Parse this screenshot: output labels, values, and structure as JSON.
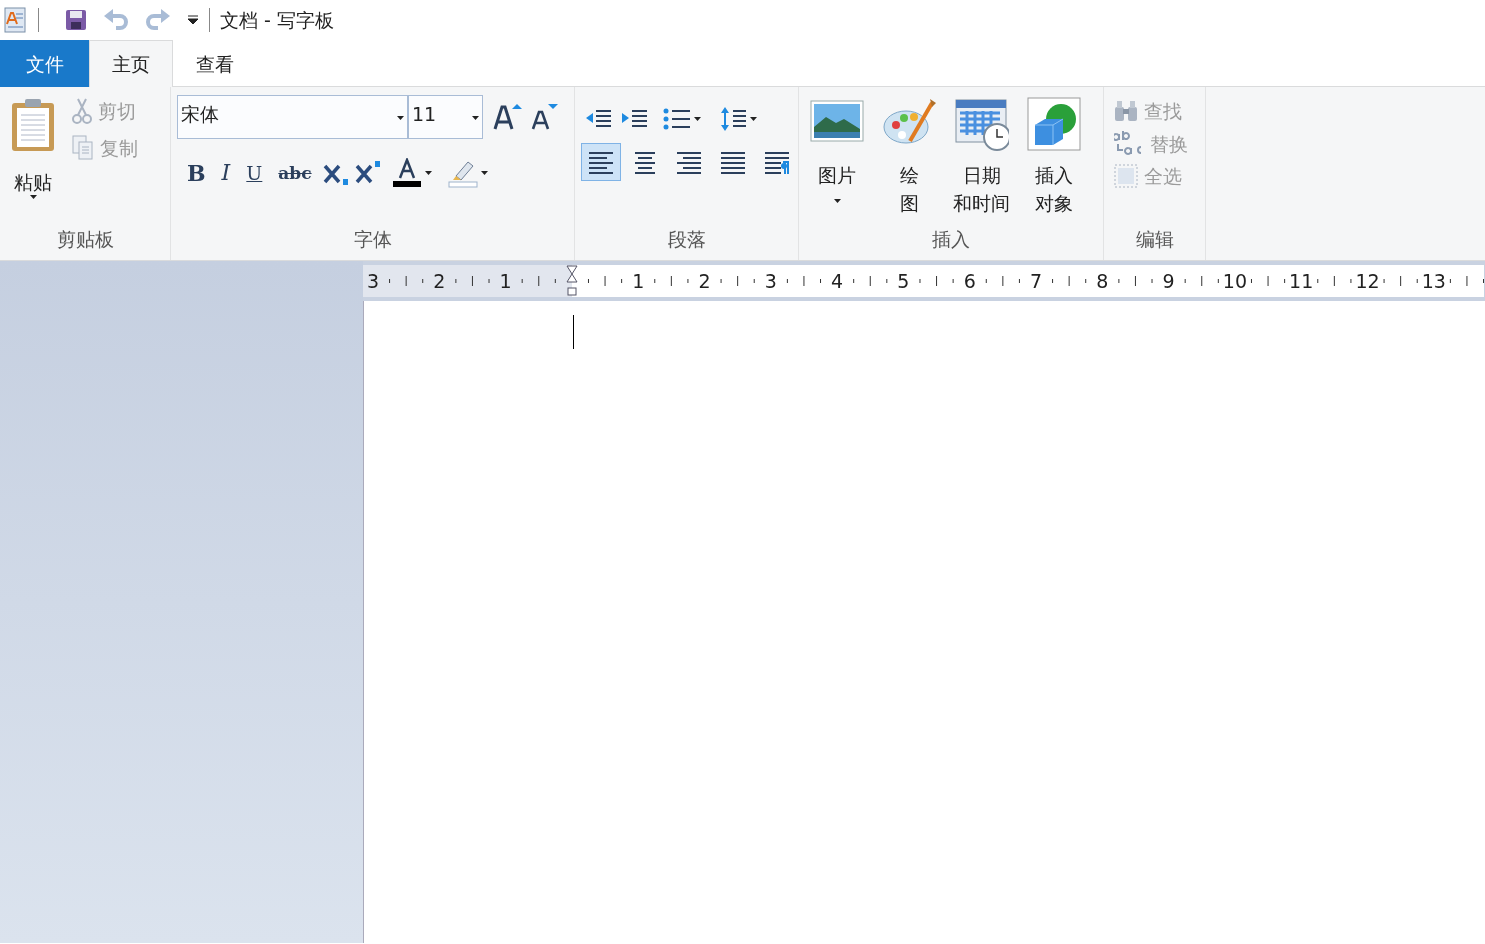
{
  "window": {
    "title": "文档 - 写字板"
  },
  "tabs": [
    {
      "label": "文件",
      "kind": "file",
      "selected": false
    },
    {
      "label": "主页",
      "kind": "tab",
      "selected": true
    },
    {
      "label": "查看",
      "kind": "tab",
      "selected": false
    }
  ],
  "ribbon": {
    "clipboard": {
      "label": "剪贴板",
      "paste": {
        "label": "粘贴"
      },
      "items": [
        {
          "label": "剪切",
          "kind": "cut",
          "disabled": true
        },
        {
          "label": "复制",
          "kind": "copy",
          "disabled": true
        }
      ]
    },
    "font": {
      "label": "字体",
      "font_name": "宋体",
      "font_size": "11",
      "styles": [
        {
          "kind": "bold",
          "label": "B"
        },
        {
          "kind": "italic",
          "label": "I"
        },
        {
          "kind": "underline",
          "label": "U"
        },
        {
          "kind": "strike",
          "label": "abc"
        },
        {
          "kind": "subscript"
        },
        {
          "kind": "superscript"
        },
        {
          "kind": "color"
        },
        {
          "kind": "highlight"
        }
      ]
    },
    "paragraph": {
      "label": "段落",
      "align": [
        {
          "kind": "left",
          "selected": true
        },
        {
          "kind": "center",
          "selected": false
        },
        {
          "kind": "right",
          "selected": false
        },
        {
          "kind": "justify",
          "selected": false
        },
        {
          "kind": "paragraph",
          "selected": false
        }
      ]
    },
    "insert": {
      "label": "插入",
      "items": [
        {
          "kind": "picture",
          "lines": [
            "图片"
          ],
          "dropdown": true
        },
        {
          "kind": "paint",
          "lines": [
            "绘",
            "图"
          ],
          "dropdown": false
        },
        {
          "kind": "datetime",
          "lines": [
            "日期",
            "和时间"
          ],
          "dropdown": false
        },
        {
          "kind": "object",
          "lines": [
            "插入",
            "对象"
          ],
          "dropdown": false
        }
      ]
    },
    "editing": {
      "label": "编辑",
      "items": [
        {
          "kind": "find",
          "label": "查找"
        },
        {
          "kind": "replace",
          "label": "替换"
        },
        {
          "kind": "selectall",
          "label": "全选"
        }
      ]
    }
  },
  "ruler": {
    "labels": [
      "3",
      "2",
      "1",
      "1",
      "2",
      "3",
      "4",
      "5",
      "6",
      "7",
      "8",
      "9",
      "10",
      "11",
      "12",
      "13"
    ]
  }
}
